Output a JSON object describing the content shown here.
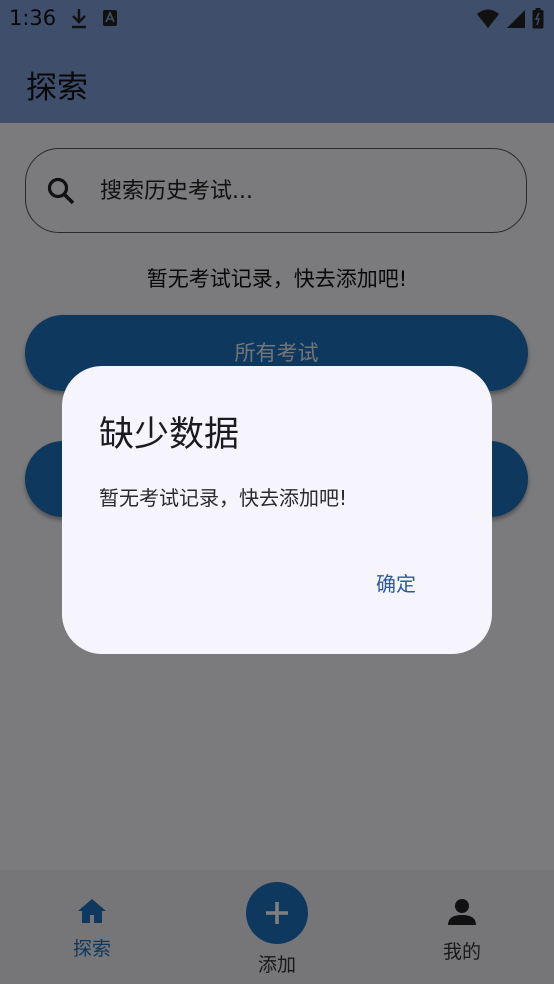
{
  "status_bar": {
    "time": "1:36",
    "icons": [
      "download-icon",
      "keyboard-icon",
      "wifi-icon",
      "signal-icon",
      "battery-icon"
    ]
  },
  "app_bar": {
    "title": "探索"
  },
  "search": {
    "placeholder": "搜索历史考试..."
  },
  "empty_message": "暂无考试记录，快去添加吧!",
  "buttons": {
    "all_exams": "所有考试",
    "second": ""
  },
  "bottom_nav": {
    "items": [
      {
        "label": "探索",
        "icon": "home-icon",
        "selected": true
      },
      {
        "label": "添加",
        "icon": "plus-icon"
      },
      {
        "label": "我的",
        "icon": "person-icon"
      }
    ]
  },
  "dialog": {
    "title": "缺少数据",
    "message": "暂无考试记录，快去添加吧!",
    "confirm_label": "确定"
  },
  "colors": {
    "app_bar": "#7e9cd4",
    "primary": "#1d71bd",
    "dialog_bg": "#f6f5fd",
    "dialog_action": "#2e5a9a"
  }
}
